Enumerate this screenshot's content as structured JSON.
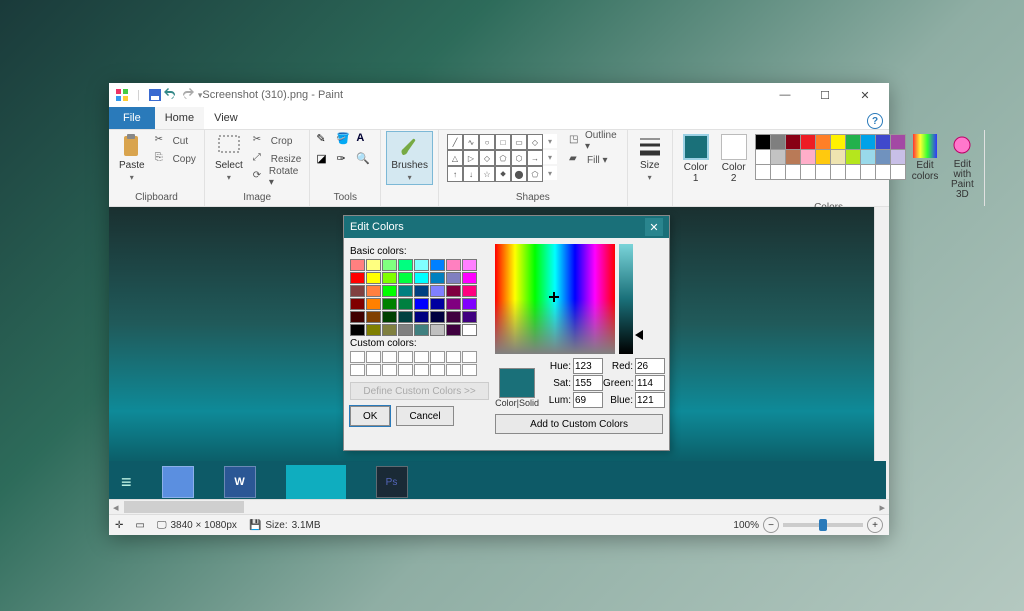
{
  "titlebar": {
    "document_title": "Screenshot (310).png - Paint"
  },
  "window_controls": {
    "min": "—",
    "max": "☐",
    "close": "✕"
  },
  "tabs": {
    "file": "File",
    "home": "Home",
    "view": "View"
  },
  "ribbon": {
    "clipboard": {
      "paste": "Paste",
      "cut": "Cut",
      "copy": "Copy",
      "label": "Clipboard"
    },
    "image": {
      "select": "Select",
      "crop": "Crop",
      "resize": "Resize",
      "rotate": "Rotate ▾",
      "label": "Image"
    },
    "tools": {
      "label": "Tools"
    },
    "brushes": {
      "label": "Brushes"
    },
    "shapes": {
      "outline": "Outline ▾",
      "fill": "Fill ▾",
      "label": "Shapes"
    },
    "size": {
      "label": "Size"
    },
    "color1": "Color 1",
    "color2": "Color 2",
    "edit_colors": "Edit colors",
    "edit_3d": "Edit with Paint 3D",
    "colors_label": "Colors"
  },
  "dialog": {
    "title": "Edit Colors",
    "basic_colors_label": "Basic colors:",
    "custom_colors_label": "Custom colors:",
    "define": "Define Custom Colors >>",
    "ok": "OK",
    "cancel": "Cancel",
    "color_solid": "Color|Solid",
    "hue_label": "Hue:",
    "hue": "123",
    "sat_label": "Sat:",
    "sat": "155",
    "lum_label": "Lum:",
    "lum": "69",
    "red_label": "Red:",
    "red": "26",
    "green_label": "Green:",
    "green": "114",
    "blue_label": "Blue:",
    "blue": "121",
    "add_custom": "Add to Custom Colors"
  },
  "status": {
    "dims": "3840 × 1080px",
    "size_label": "Size:",
    "size": "3.1MB",
    "zoom": "100%"
  }
}
